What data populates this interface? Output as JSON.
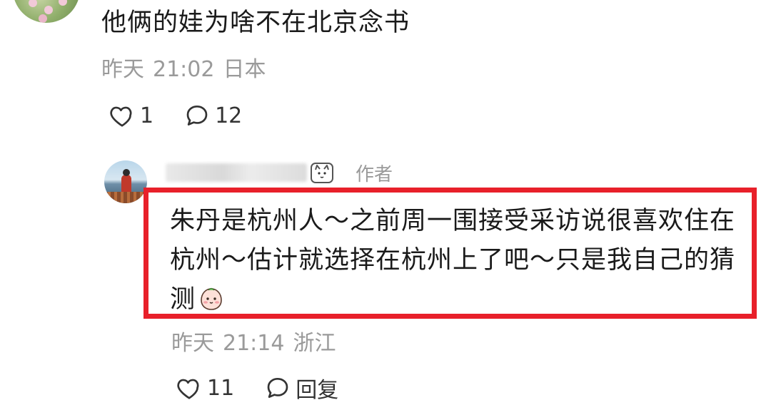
{
  "comment": {
    "text": "他俩的娃为啥不在北京念书",
    "date": "昨天",
    "time": "21:02",
    "location": "日本",
    "like_count": "1",
    "reply_count": "12"
  },
  "reply": {
    "author_tag": "作者",
    "text": "朱丹是杭州人～之前周一围接受采访说很喜欢住在杭州～估计就选择在杭州上了吧～只是我自己的猜测",
    "date": "昨天",
    "time": "21:14",
    "location": "浙江",
    "like_count": "11",
    "reply_label": "回复"
  },
  "colors": {
    "highlight": "#e8202a",
    "meta": "#9a9a9a"
  },
  "icons": [
    "heart-icon",
    "comment-bubble-icon",
    "face-emoji-icon",
    "cat-badge-icon"
  ]
}
